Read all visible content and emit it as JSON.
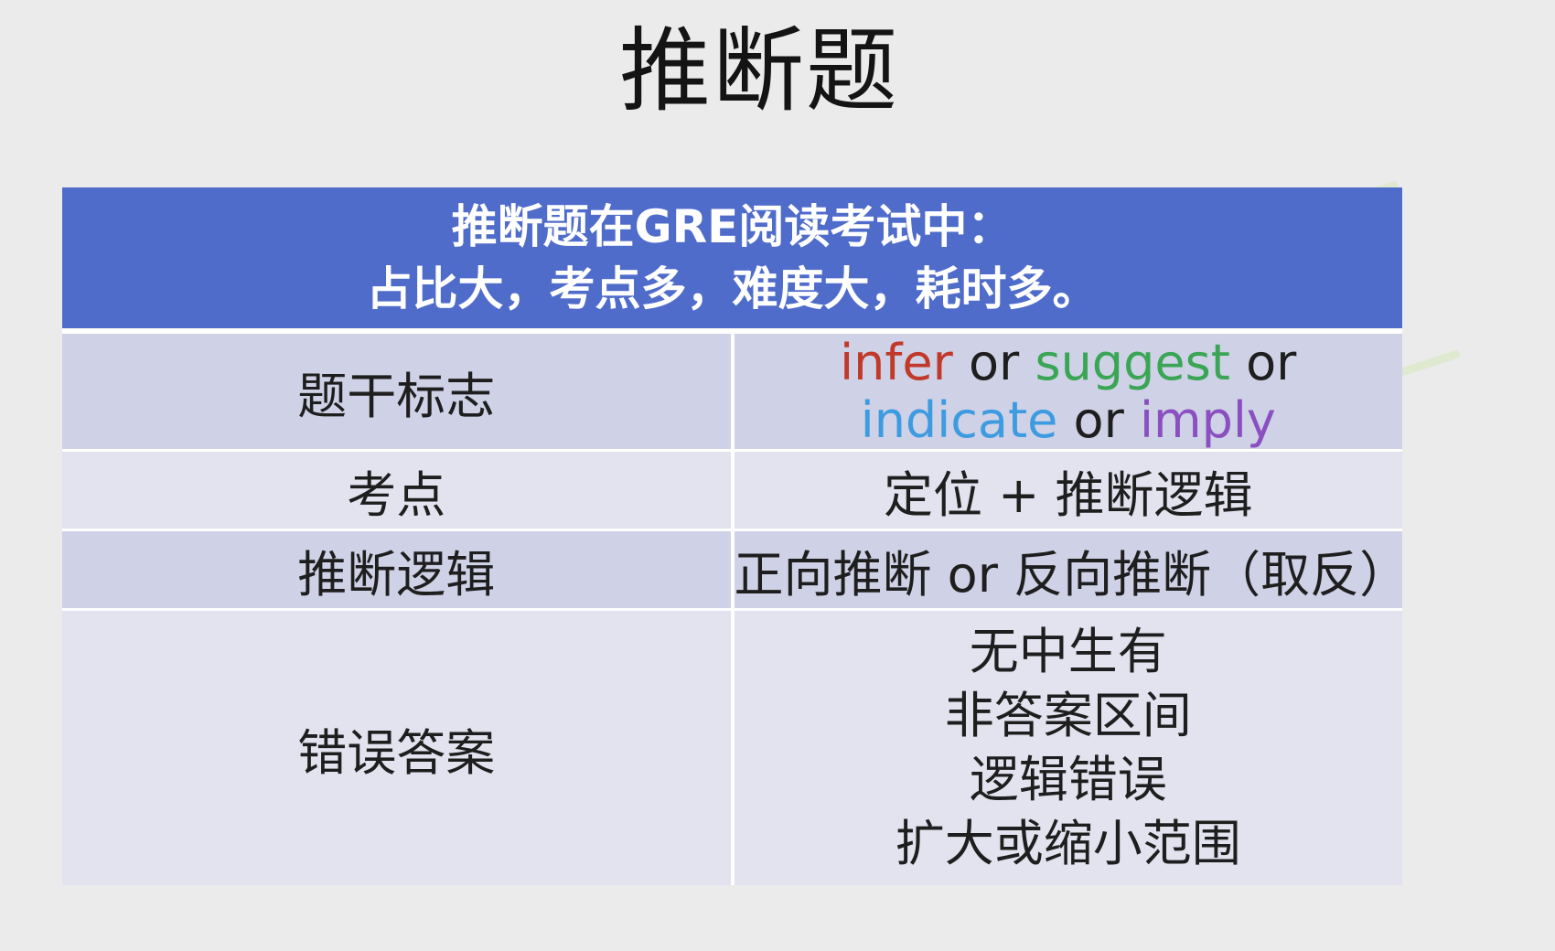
{
  "title": "推断题",
  "table": {
    "header_line1": "推断题在GRE阅读考试中：",
    "header_line2": "占比大，考点多，难度大，耗时多。",
    "rows": {
      "marker": {
        "label": "题干标志",
        "keywords": [
          {
            "text": "infer",
            "color": "#c0392b"
          },
          {
            "text": "suggest",
            "color": "#3aa655"
          },
          {
            "text": "indicate",
            "color": "#3d9be0"
          },
          {
            "text": "imply",
            "color": "#8a4fc0"
          }
        ],
        "separator": "or"
      },
      "points": {
        "label": "考点",
        "value": "定位 + 推断逻辑"
      },
      "logic": {
        "label": "推断逻辑",
        "value": "正向推断 or 反向推断（取反）"
      },
      "wrong": {
        "label": "错误答案",
        "items": [
          "无中生有",
          "非答案区间",
          "逻辑错误",
          "扩大或缩小范围"
        ]
      }
    }
  },
  "colors": {
    "header_bg": "#4f6ccb",
    "row_dark": "#cfd1e6",
    "row_light": "#e2e3ef",
    "background": "#ebebeb"
  }
}
